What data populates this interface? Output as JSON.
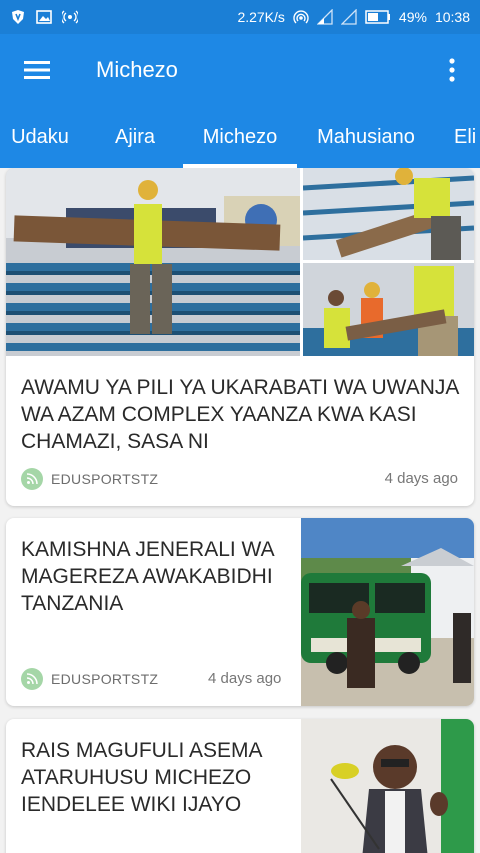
{
  "status": {
    "speed": "2.27K/s",
    "battery": "49%",
    "time": "10:38"
  },
  "appbar": {
    "title": "Michezo"
  },
  "tabs": [
    "Udaku",
    "Ajira",
    "Michezo",
    "Mahusiano",
    "Eli"
  ],
  "active_tab": "Michezo",
  "articles": [
    {
      "title": "AWAMU YA PILI YA UKARABATI WA UWANJA WA AZAM COMPLEX YAANZA KWA KASI CHAMAZI, SASA NI",
      "source": "EDUSPORTSTZ",
      "time": "4 days ago"
    },
    {
      "title": "KAMISHNA JENERALI WA MAGEREZA AWAKABIDHI TANZANIA",
      "source": "EDUSPORTSTZ",
      "time": "4 days ago"
    },
    {
      "title": "RAIS MAGUFULI ASEMA ATARUHUSU MICHEZO IENDELEE WIKI IJAYO",
      "source": "",
      "time": ""
    }
  ],
  "colors": {
    "appbar": "#1e88e5",
    "statusbar": "#1b7fd6",
    "source_icon": "#a5d6a7"
  }
}
